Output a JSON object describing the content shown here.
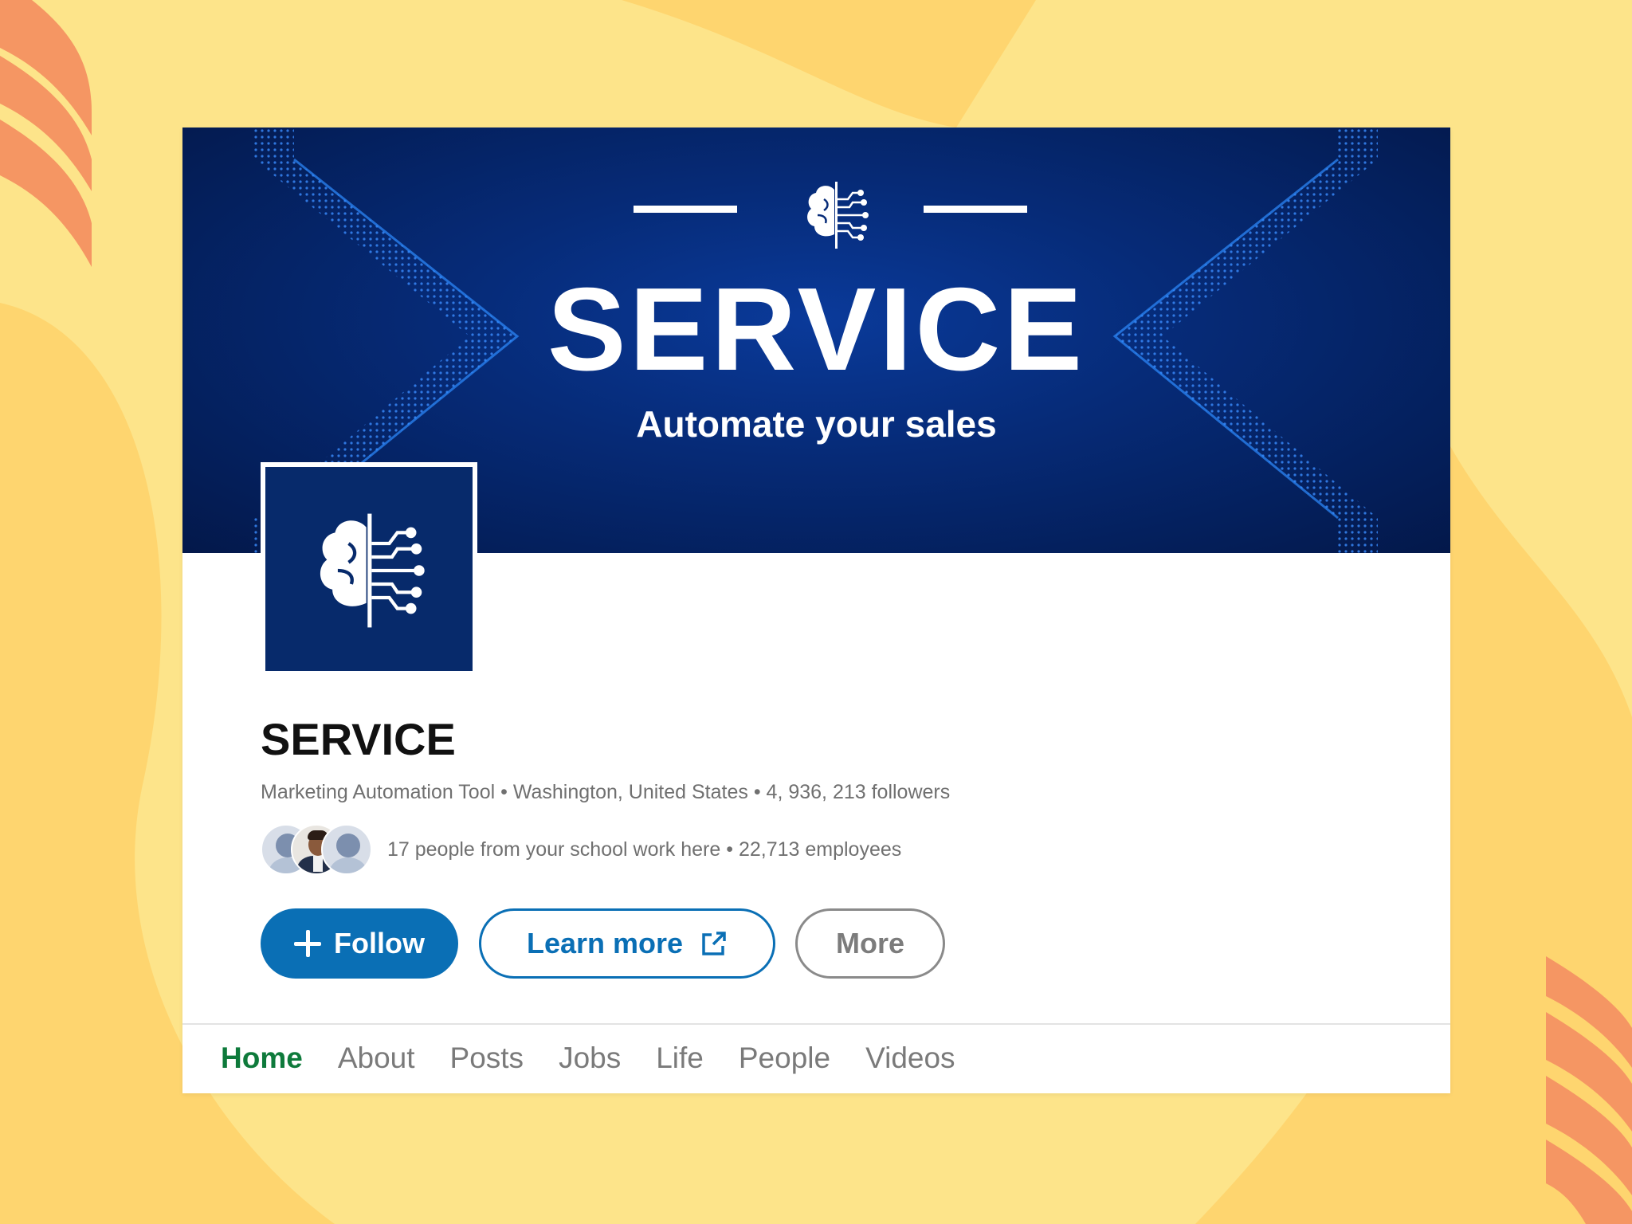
{
  "banner": {
    "title": "SERVICE",
    "subtitle": "Automate your sales",
    "logo_icon": "brain-circuit-icon"
  },
  "company": {
    "name": "SERVICE",
    "industry": "Marketing Automation Tool",
    "location": "Washington, United States",
    "followers": "4, 936, 213 followers",
    "logo_icon": "brain-circuit-icon"
  },
  "insights": {
    "school_text": "17 people from your school work here",
    "employees": "22,713 employees",
    "separator": " • "
  },
  "buttons": {
    "follow": "Follow",
    "learn_more": "Learn more",
    "more": "More"
  },
  "tabs": [
    {
      "label": "Home",
      "active": true
    },
    {
      "label": "About",
      "active": false
    },
    {
      "label": "Posts",
      "active": false
    },
    {
      "label": "Jobs",
      "active": false
    },
    {
      "label": "Life",
      "active": false
    },
    {
      "label": "People",
      "active": false
    },
    {
      "label": "Videos",
      "active": false
    }
  ],
  "colors": {
    "background": "#fde48a",
    "accent": "#0a6fb5",
    "active_tab": "#0e7a3b",
    "banner": "#062b78",
    "decor_stripes": "#f59663"
  }
}
